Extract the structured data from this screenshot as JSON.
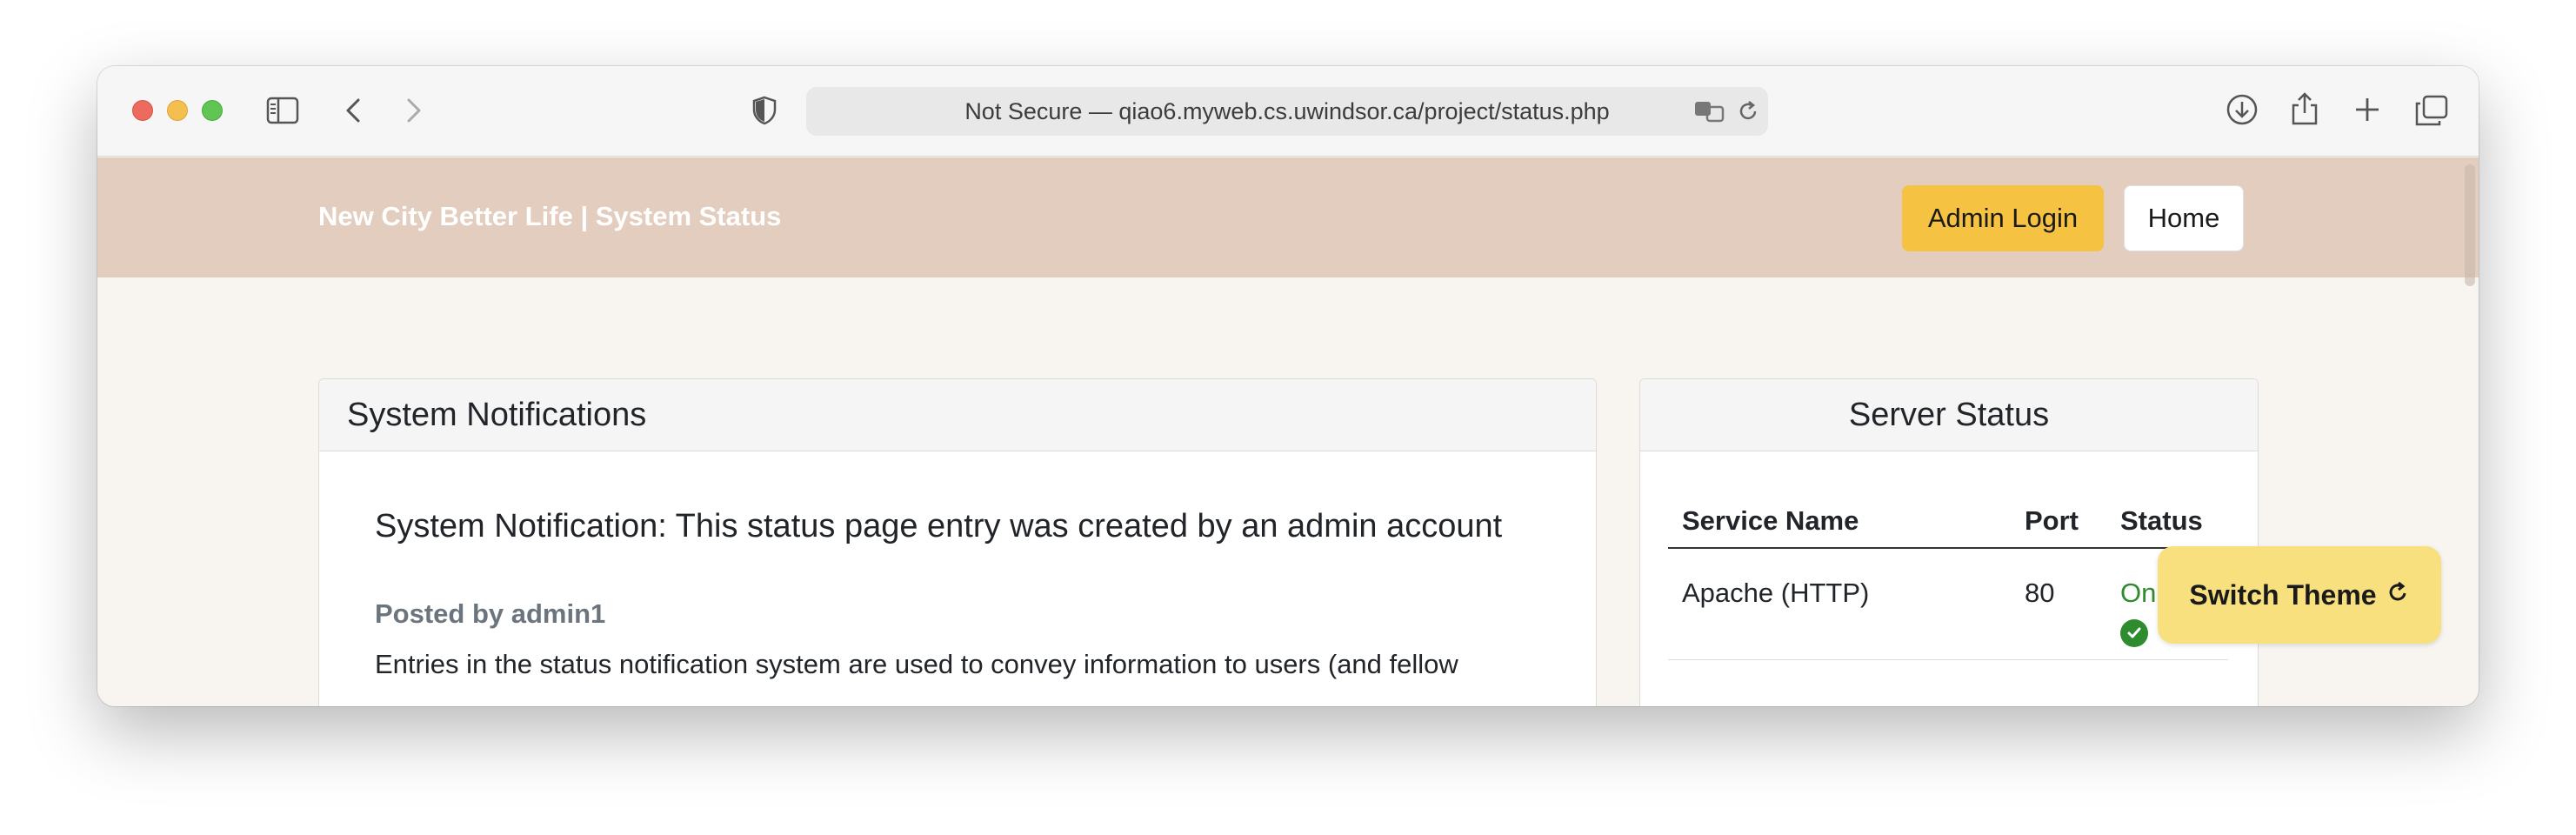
{
  "browser": {
    "url_text": "Not Secure — qiao6.myweb.cs.uwindsor.ca/project/status.php"
  },
  "navbar": {
    "brand": "New City Better Life | System Status",
    "admin_login": "Admin Login",
    "home": "Home"
  },
  "notifications": {
    "header": "System Notifications",
    "title": "System Notification: This status page entry was created by an admin account",
    "meta": "Posted by admin1",
    "body": "Entries in the status notification system are used to convey information to users (and fellow"
  },
  "server_status": {
    "header": "Server Status",
    "columns": [
      "Service Name",
      "Port",
      "Status"
    ],
    "rows": [
      {
        "service": "Apache (HTTP)",
        "port": "80",
        "status": "On"
      }
    ]
  },
  "switch_theme": {
    "label": "Switch Theme"
  },
  "colors": {
    "navbar": "#e3cdbf",
    "admin_button": "#f5c242",
    "status_on": "#2e8b2e",
    "switch_theme": "#f8e07f"
  }
}
